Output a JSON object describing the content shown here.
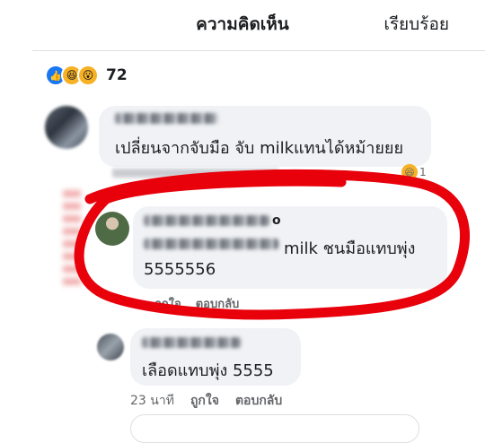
{
  "header": {
    "title": "ความคิดเห็น",
    "done_label": "เรียบร้อย"
  },
  "reactions": {
    "count": "72",
    "icons": [
      "like-icon",
      "haha-icon",
      "wow-icon"
    ]
  },
  "comments": [
    {
      "text": "เปลี่ยนจากจับมือ จับ milkแทนได้หม้ายยย",
      "reaction_count": "1"
    },
    {
      "name_suffix": "o",
      "text_line1": "milk ชนมือแทบพุ่ง",
      "text_line2": "5555556",
      "actions": [
        "ถูกใจ",
        "ตอบกลับ"
      ]
    },
    {
      "text": "เลือดแทบพุ่ง 5555",
      "time": "23 นาที",
      "like_label": "ถูกใจ",
      "reply_label": "ตอบกลับ"
    }
  ],
  "colors": {
    "accent": "#1877f2",
    "bubble": "#f0f2f5",
    "annotation": "#e8000b"
  }
}
